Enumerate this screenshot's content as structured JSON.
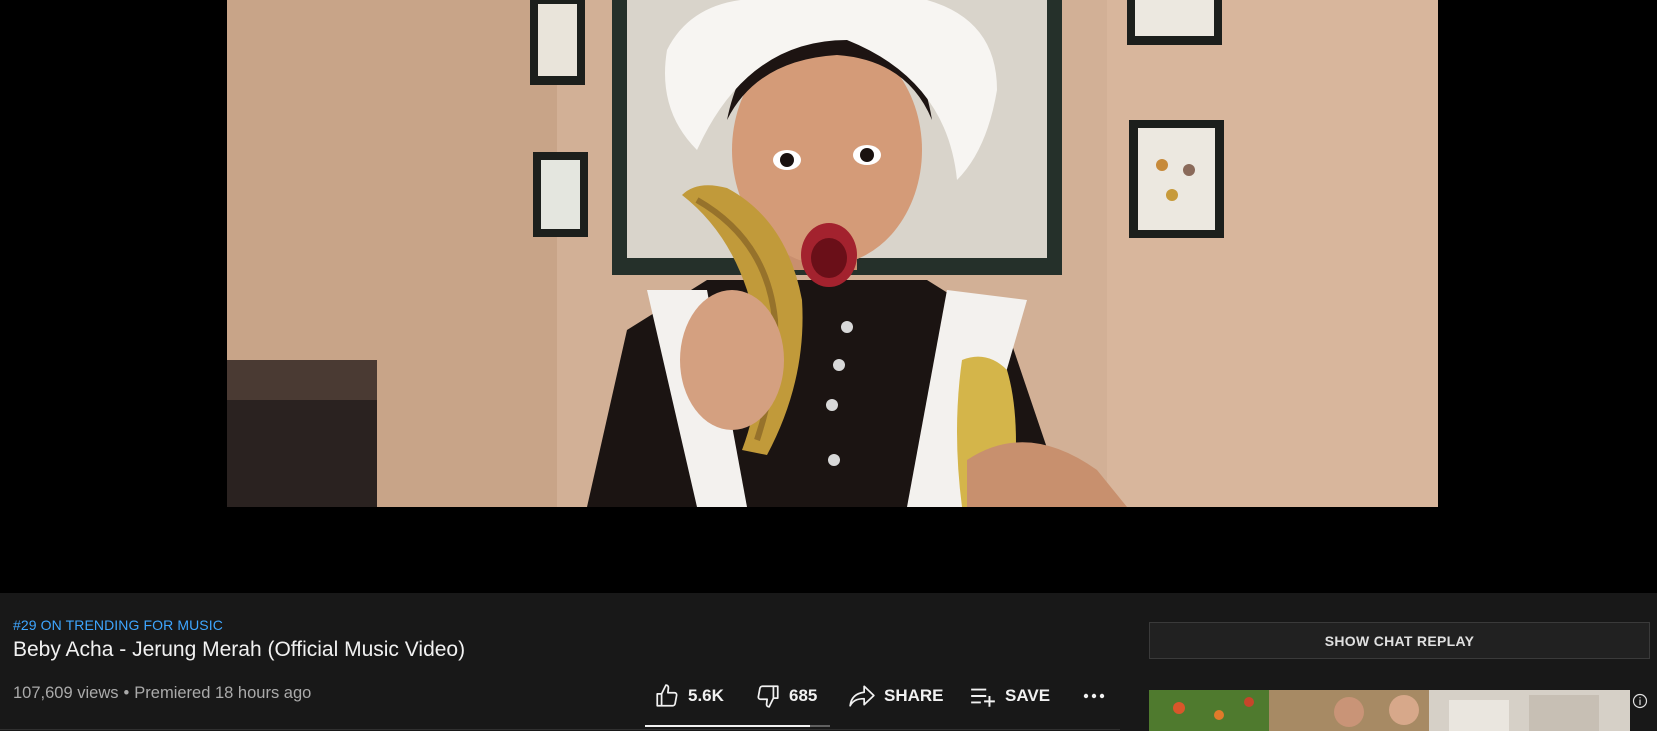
{
  "trending": {
    "label": "#29 ON TRENDING FOR MUSIC"
  },
  "video": {
    "title": "Beby Acha - Jerung Merah (Official Music Video)",
    "views": "107,609 views",
    "separator": "•",
    "premiered": "Premiered 18 hours ago"
  },
  "actions": {
    "like_count": "5.6K",
    "dislike_count": "685",
    "share_label": "SHARE",
    "save_label": "SAVE",
    "like_ratio": 0.89,
    "icons": {
      "like": "thumbs-up-icon",
      "dislike": "thumbs-down-icon",
      "share": "share-arrow-icon",
      "save": "playlist-add-icon",
      "more": "more-horizontal-icon"
    }
  },
  "chat": {
    "show_replay_label": "SHOW CHAT REPLAY"
  },
  "colors": {
    "background": "#181818",
    "player_background": "#000000",
    "trending_link": "#3ea6ff",
    "primary_text": "#f1f1f1",
    "secondary_text": "#aaaaaa"
  }
}
